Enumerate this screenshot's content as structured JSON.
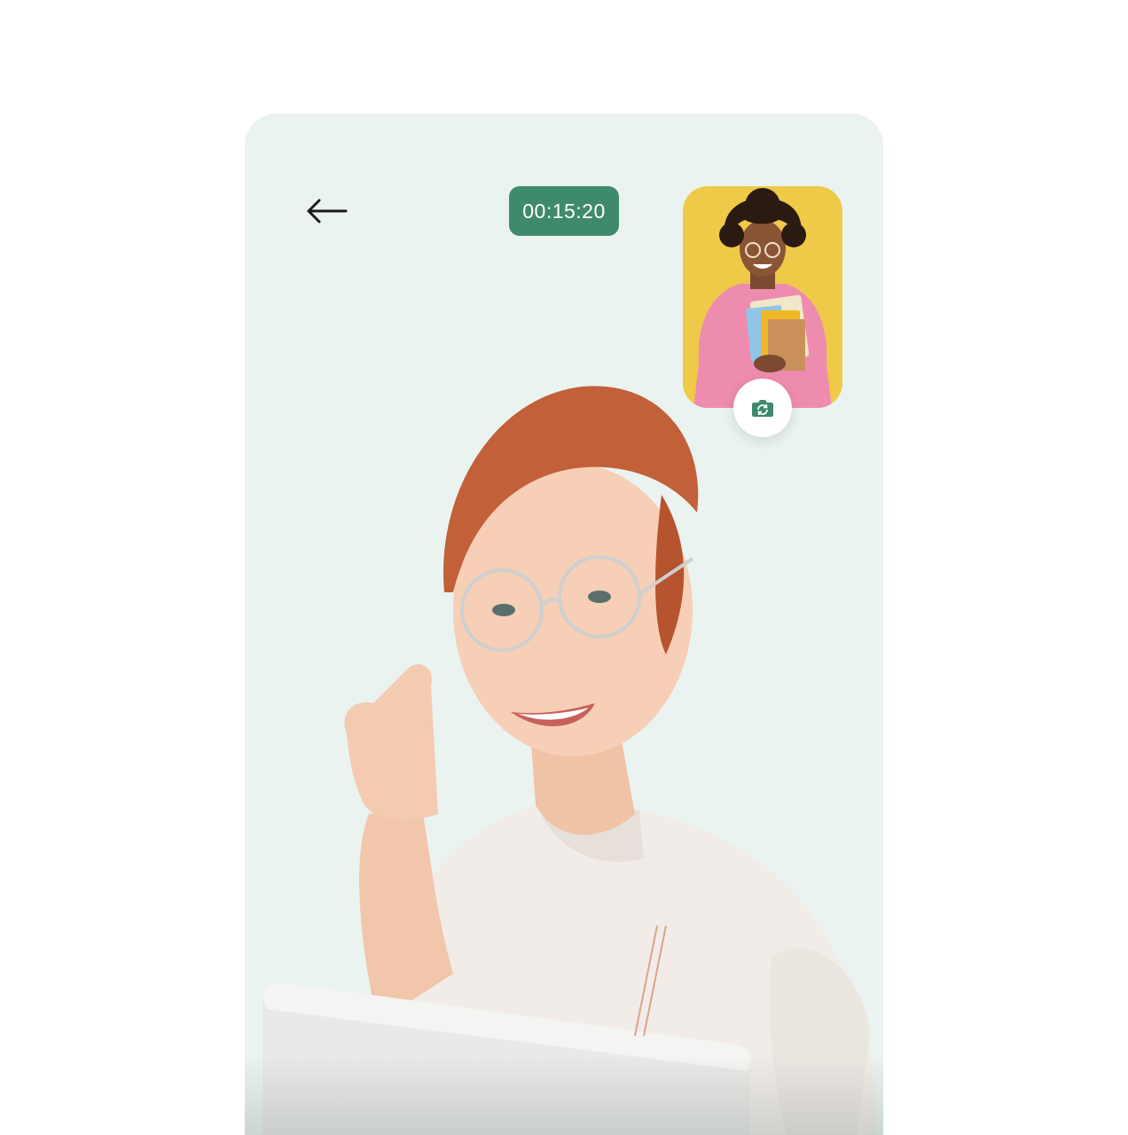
{
  "call": {
    "timer": "00:15:20"
  },
  "icons": {
    "back": "arrow-left-icon",
    "switch_camera": "camera-rotate-icon"
  },
  "colors": {
    "screen_background": "#ebf3f0",
    "timer_badge": "#3f8a6c",
    "pip_background": "#efca48",
    "switch_icon": "#3f8a6c"
  }
}
